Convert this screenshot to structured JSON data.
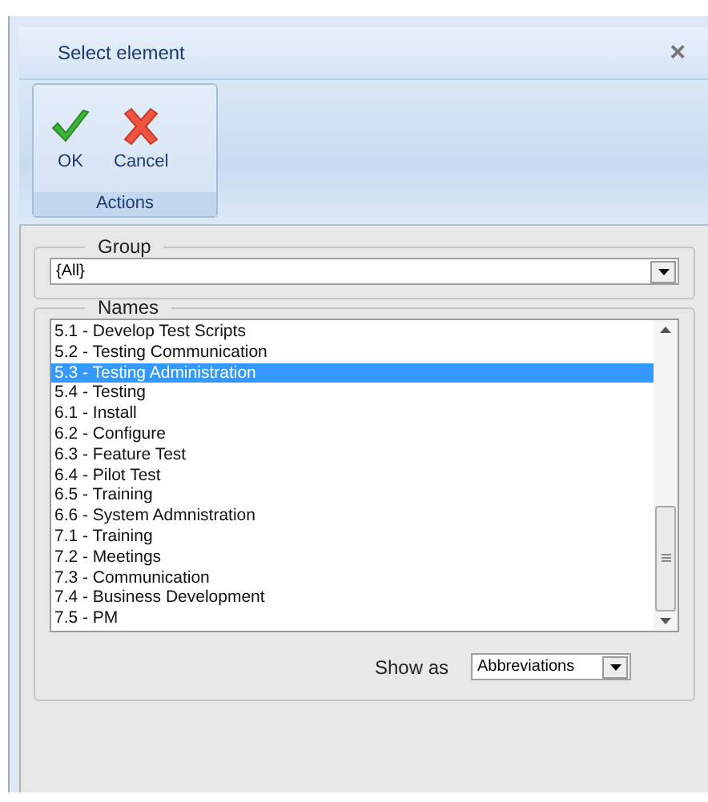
{
  "window": {
    "title": "Select element",
    "close": "×"
  },
  "ribbon": {
    "group": "Actions",
    "buttons": [
      {
        "kind": "ok",
        "label": "OK"
      },
      {
        "kind": "cancel",
        "label": "Cancel"
      }
    ]
  },
  "group": {
    "legend": "Group",
    "value": "{All}"
  },
  "names": {
    "legend": "Names",
    "items": [
      {
        "label": "5.1 - Develop Test Scripts",
        "selected": false
      },
      {
        "label": "5.2 - Testing Communication",
        "selected": false
      },
      {
        "label": "5.3 - Testing Administration",
        "selected": true
      },
      {
        "label": "5.4 - Testing",
        "selected": false
      },
      {
        "label": "6.1 - Install",
        "selected": false
      },
      {
        "label": "6.2 - Configure",
        "selected": false
      },
      {
        "label": "6.3 - Feature Test",
        "selected": false
      },
      {
        "label": "6.4 - Pilot Test",
        "selected": false
      },
      {
        "label": "6.5 - Training",
        "selected": false
      },
      {
        "label": "6.6 - System Admnistration",
        "selected": false
      },
      {
        "label": "7.1 - Training",
        "selected": false
      },
      {
        "label": "7.2 - Meetings",
        "selected": false
      },
      {
        "label": "7.3 - Communication",
        "selected": false
      },
      {
        "label": "7.4 - Business Development",
        "selected": false
      },
      {
        "label": "7.5 - PM",
        "selected": false
      }
    ],
    "show_as_label": "Show as",
    "show_as_value": "Abbreviations"
  }
}
